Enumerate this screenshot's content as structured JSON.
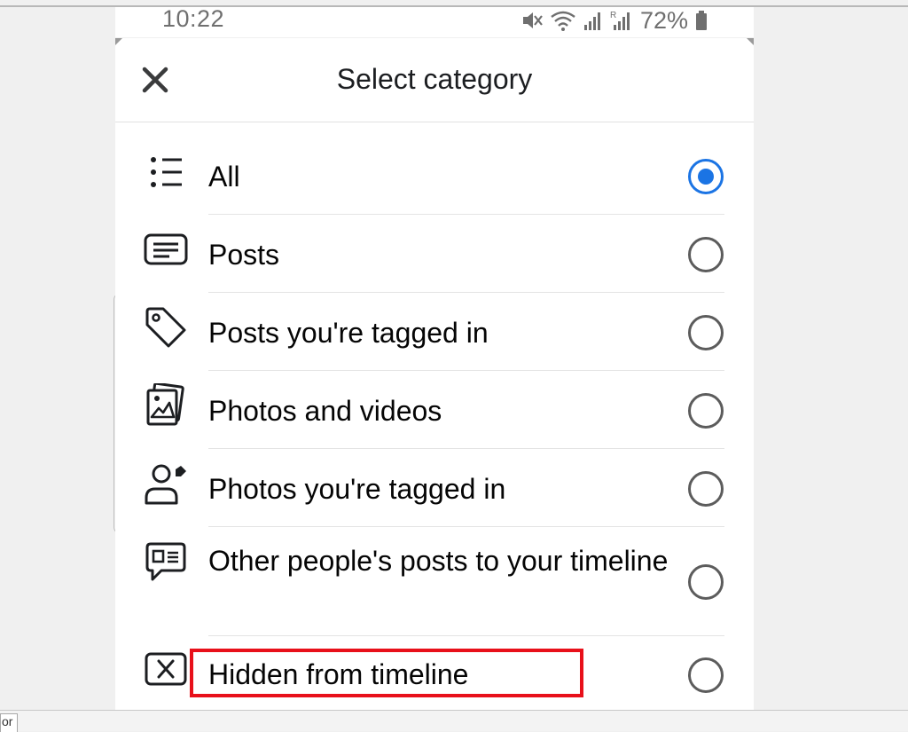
{
  "status_bar": {
    "time": "10:22",
    "battery_percent": "72%",
    "icons": [
      "mute-icon",
      "wifi-icon",
      "signal-icon",
      "signal-r-icon",
      "battery-icon"
    ]
  },
  "sheet": {
    "title": "Select category",
    "close_icon": "close-icon",
    "options": [
      {
        "label": "All",
        "icon": "list-icon",
        "selected": true
      },
      {
        "label": "Posts",
        "icon": "post-icon",
        "selected": false
      },
      {
        "label": "Posts you're tagged in",
        "icon": "tag-icon",
        "selected": false
      },
      {
        "label": "Photos and videos",
        "icon": "photos-icon",
        "selected": false
      },
      {
        "label": "Photos you're tagged in",
        "icon": "person-tag-icon",
        "selected": false
      },
      {
        "label": "Other people's posts to your timeline",
        "icon": "comment-post-icon",
        "selected": false
      },
      {
        "label": "Hidden from timeline",
        "icon": "hidden-icon",
        "selected": false
      }
    ],
    "accent_color": "#1b74e4",
    "highlight_color": "#e8101a"
  },
  "bottom_bar": {
    "tab_label": "or"
  }
}
